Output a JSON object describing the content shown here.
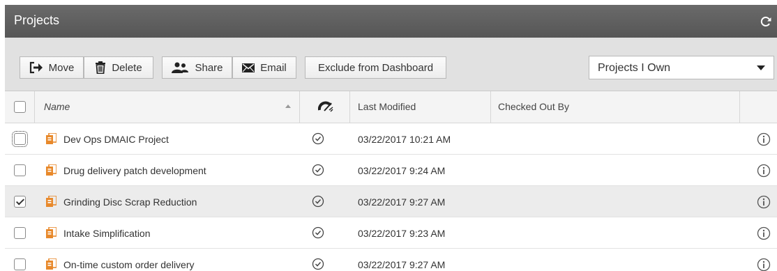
{
  "header": {
    "title": "Projects",
    "refresh_icon": "refresh-icon"
  },
  "toolbar": {
    "move_label": "Move",
    "delete_label": "Delete",
    "share_label": "Share",
    "email_label": "Email",
    "exclude_label": "Exclude from Dashboard",
    "filter_selected": "Projects I Own"
  },
  "table": {
    "columns": {
      "name": "Name",
      "status_icon": "status-gauge-icon",
      "last_modified": "Last Modified",
      "checked_out_by": "Checked Out By"
    },
    "rows": [
      {
        "name": "Dev Ops DMAIC Project",
        "last_modified": "03/22/2017 10:21 AM",
        "checked_out_by": "",
        "checked": false
      },
      {
        "name": "Drug delivery patch development",
        "last_modified": "03/22/2017 9:24 AM",
        "checked_out_by": "",
        "checked": false
      },
      {
        "name": "Grinding Disc Scrap Reduction",
        "last_modified": "03/22/2017 9:27 AM",
        "checked_out_by": "",
        "checked": true
      },
      {
        "name": "Intake Simplification",
        "last_modified": "03/22/2017 9:23 AM",
        "checked_out_by": "",
        "checked": false
      },
      {
        "name": "On-time custom order delivery",
        "last_modified": "03/22/2017 9:27 AM",
        "checked_out_by": "",
        "checked": false
      }
    ]
  },
  "colors": {
    "titlebar": "#5e5e5e",
    "toolbar": "#e1e1e1",
    "project_icon": "#e8892b",
    "selected_row": "#ececec"
  }
}
